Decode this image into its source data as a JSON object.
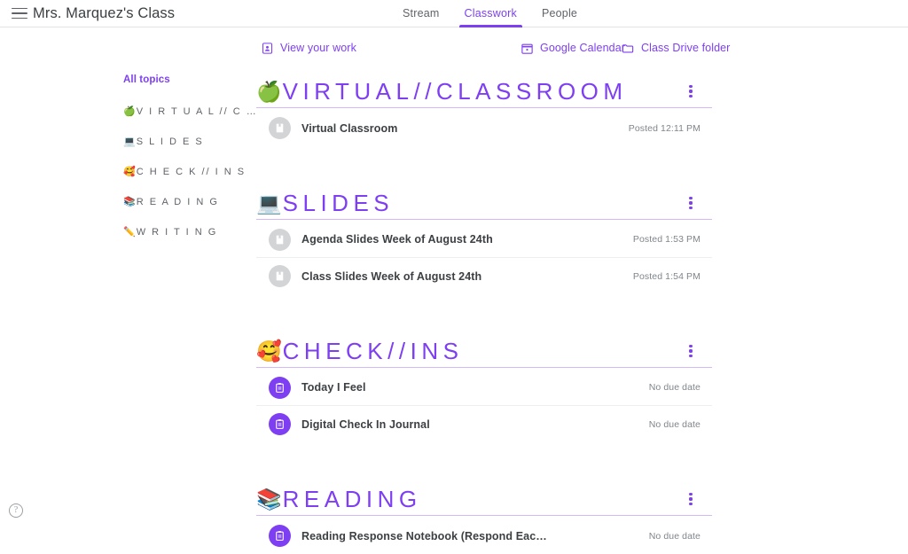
{
  "appbar": {
    "menu_icon": "hamburger-icon",
    "class_title": "Mrs. Marquez's Class",
    "tabs": [
      {
        "label": "Stream",
        "active": false
      },
      {
        "label": "Classwork",
        "active": true
      },
      {
        "label": "People",
        "active": false
      }
    ]
  },
  "toolbar": {
    "view_work": {
      "label": "View your work",
      "icon": "assignment-ind-icon"
    },
    "google_calendar": {
      "label": "Google Calendar",
      "icon": "calendar-icon"
    },
    "class_drive": {
      "label": "Class Drive folder",
      "icon": "folder-icon"
    }
  },
  "topics": {
    "all_label": "All topics",
    "items": [
      {
        "emoji": "🍏",
        "label": "V I R T U A L // C …"
      },
      {
        "emoji": "💻",
        "label": "S L I D E S"
      },
      {
        "emoji": "🥰",
        "label": "C H E C K // I N S"
      },
      {
        "emoji": "📚",
        "label": "R E A D I N G"
      },
      {
        "emoji": "✏️",
        "label": "W R I T I N G"
      }
    ]
  },
  "sections": [
    {
      "emoji": "🍏",
      "title": "VIRTUAL//CLASSROOM",
      "menu_icon": "more-vert-icon",
      "items": [
        {
          "icon": "material-post-icon",
          "icon_color": "gray",
          "title": "Virtual Classroom",
          "meta": "Posted 12:11 PM"
        }
      ]
    },
    {
      "emoji": "💻",
      "title": "SLIDES",
      "menu_icon": "more-vert-icon",
      "items": [
        {
          "icon": "material-post-icon",
          "icon_color": "gray",
          "title": "Agenda Slides Week of August 24th",
          "meta": "Posted 1:53 PM"
        },
        {
          "icon": "material-post-icon",
          "icon_color": "gray",
          "title": "Class Slides Week of August 24th",
          "meta": "Posted 1:54 PM"
        }
      ]
    },
    {
      "emoji": "🥰",
      "title": "CHECK//INS",
      "menu_icon": "more-vert-icon",
      "items": [
        {
          "icon": "assignment-icon",
          "icon_color": "purple",
          "title": "Today I Feel",
          "meta": "No due date"
        },
        {
          "icon": "assignment-icon",
          "icon_color": "purple",
          "title": "Digital Check In Journal",
          "meta": "No due date"
        }
      ]
    },
    {
      "emoji": "📚",
      "title": "READING",
      "menu_icon": "more-vert-icon",
      "items": [
        {
          "icon": "assignment-icon",
          "icon_color": "purple",
          "title": "Reading Response Notebook (Respond Eac…",
          "meta": "No due date"
        }
      ]
    }
  ],
  "help": {
    "label": "?",
    "icon": "help-icon"
  },
  "colors": {
    "accent_purple": "#7e3ff2",
    "divider_purple": "#d3b9f5",
    "text_primary": "#3c4043",
    "text_secondary": "#5f6368",
    "text_muted": "#80868b",
    "icon_gray": "#d2d4d6"
  }
}
